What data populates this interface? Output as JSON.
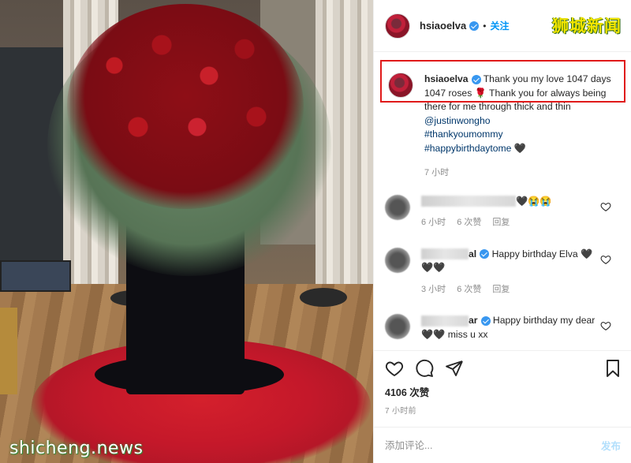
{
  "header": {
    "username": "hsiaoelva",
    "separator": "•",
    "follow_label": "关注",
    "brand_watermark": "狮城新闻"
  },
  "caption": {
    "username": "hsiaoelva",
    "text_1": "Thank you my love 1047 days 1047 roses ",
    "emoji": "🌹",
    "text_2": " Thank you for always being there for me through thick and thin ",
    "mention": "@justinwongho",
    "tag_1": "#thankyoumommy",
    "tag_2": "#happybirthdaytome",
    "heart": "🖤",
    "time": "7 小时"
  },
  "comments": [
    {
      "text_suffix": "🖤😭😭",
      "time": "6 小时",
      "likes": "6 次赞",
      "reply": "回复"
    },
    {
      "name_suffix": "al",
      "text": "Happy birthday Elva 🖤🖤🖤",
      "time": "3 小时",
      "likes": "6 次赞",
      "reply": "回复"
    },
    {
      "name_suffix": "ar",
      "text": "Happy birthday my dear 🖤🖤 miss u xx"
    }
  ],
  "actions": {
    "likes": "4106 次赞",
    "time": "7 小时前"
  },
  "add_comment": {
    "placeholder": "添加评论...",
    "post_label": "发布"
  },
  "photo": {
    "watermark": "shicheng.news"
  },
  "colors": {
    "verified": "#3897f0",
    "follow": "#0095f6",
    "link": "#00376b",
    "highlight_box": "#e01a1a",
    "brand": "#f2e500"
  }
}
